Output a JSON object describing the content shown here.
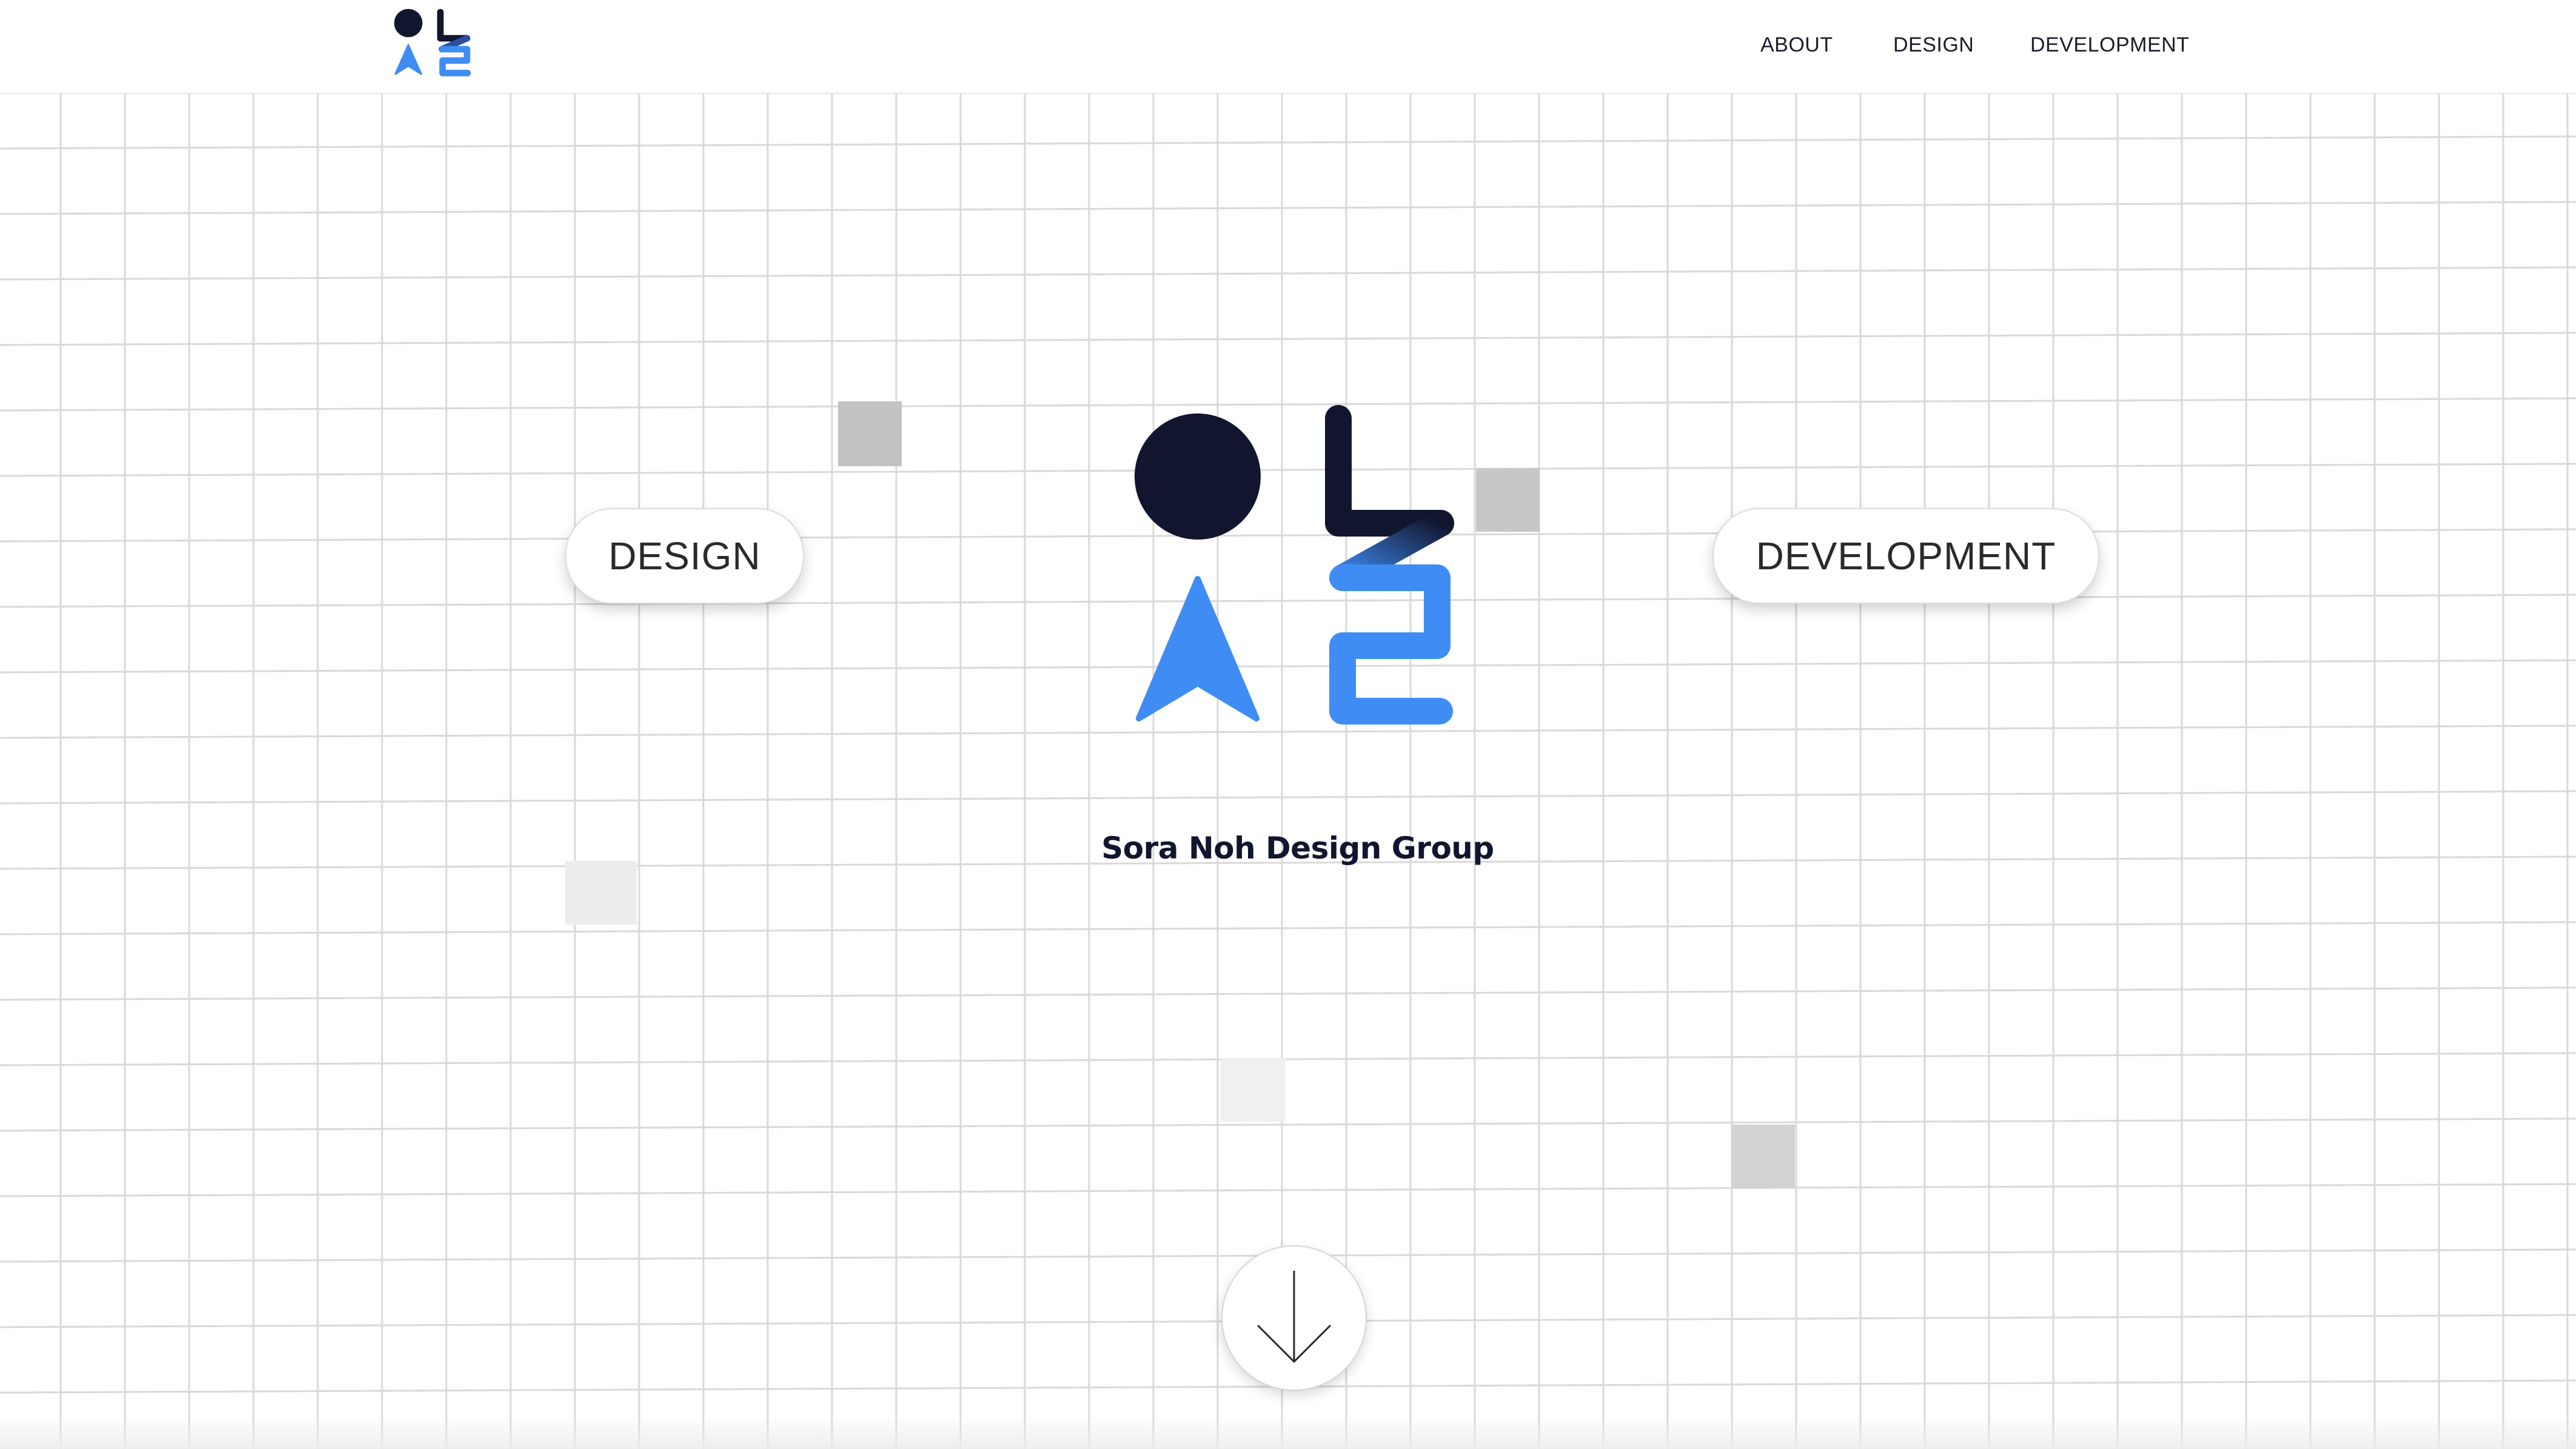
{
  "header": {
    "logo_icon": "olaz-logo-icon",
    "nav": [
      {
        "label": "ABOUT"
      },
      {
        "label": "DESIGN"
      },
      {
        "label": "DEVELOPMENT"
      }
    ]
  },
  "hero": {
    "logo_icon": "olaz-logo-icon",
    "tagline": "Sora Noh Design Group",
    "design_button": "DESIGN",
    "development_button": "DEVELOPMENT",
    "scroll_icon": "arrow-down-icon"
  },
  "colors": {
    "navy": "#12152e",
    "blue": "#3f8cf5",
    "grid_line": "#d9d9d9",
    "tile_dark": "#c2c2c2",
    "tile_light": "#ececec"
  }
}
